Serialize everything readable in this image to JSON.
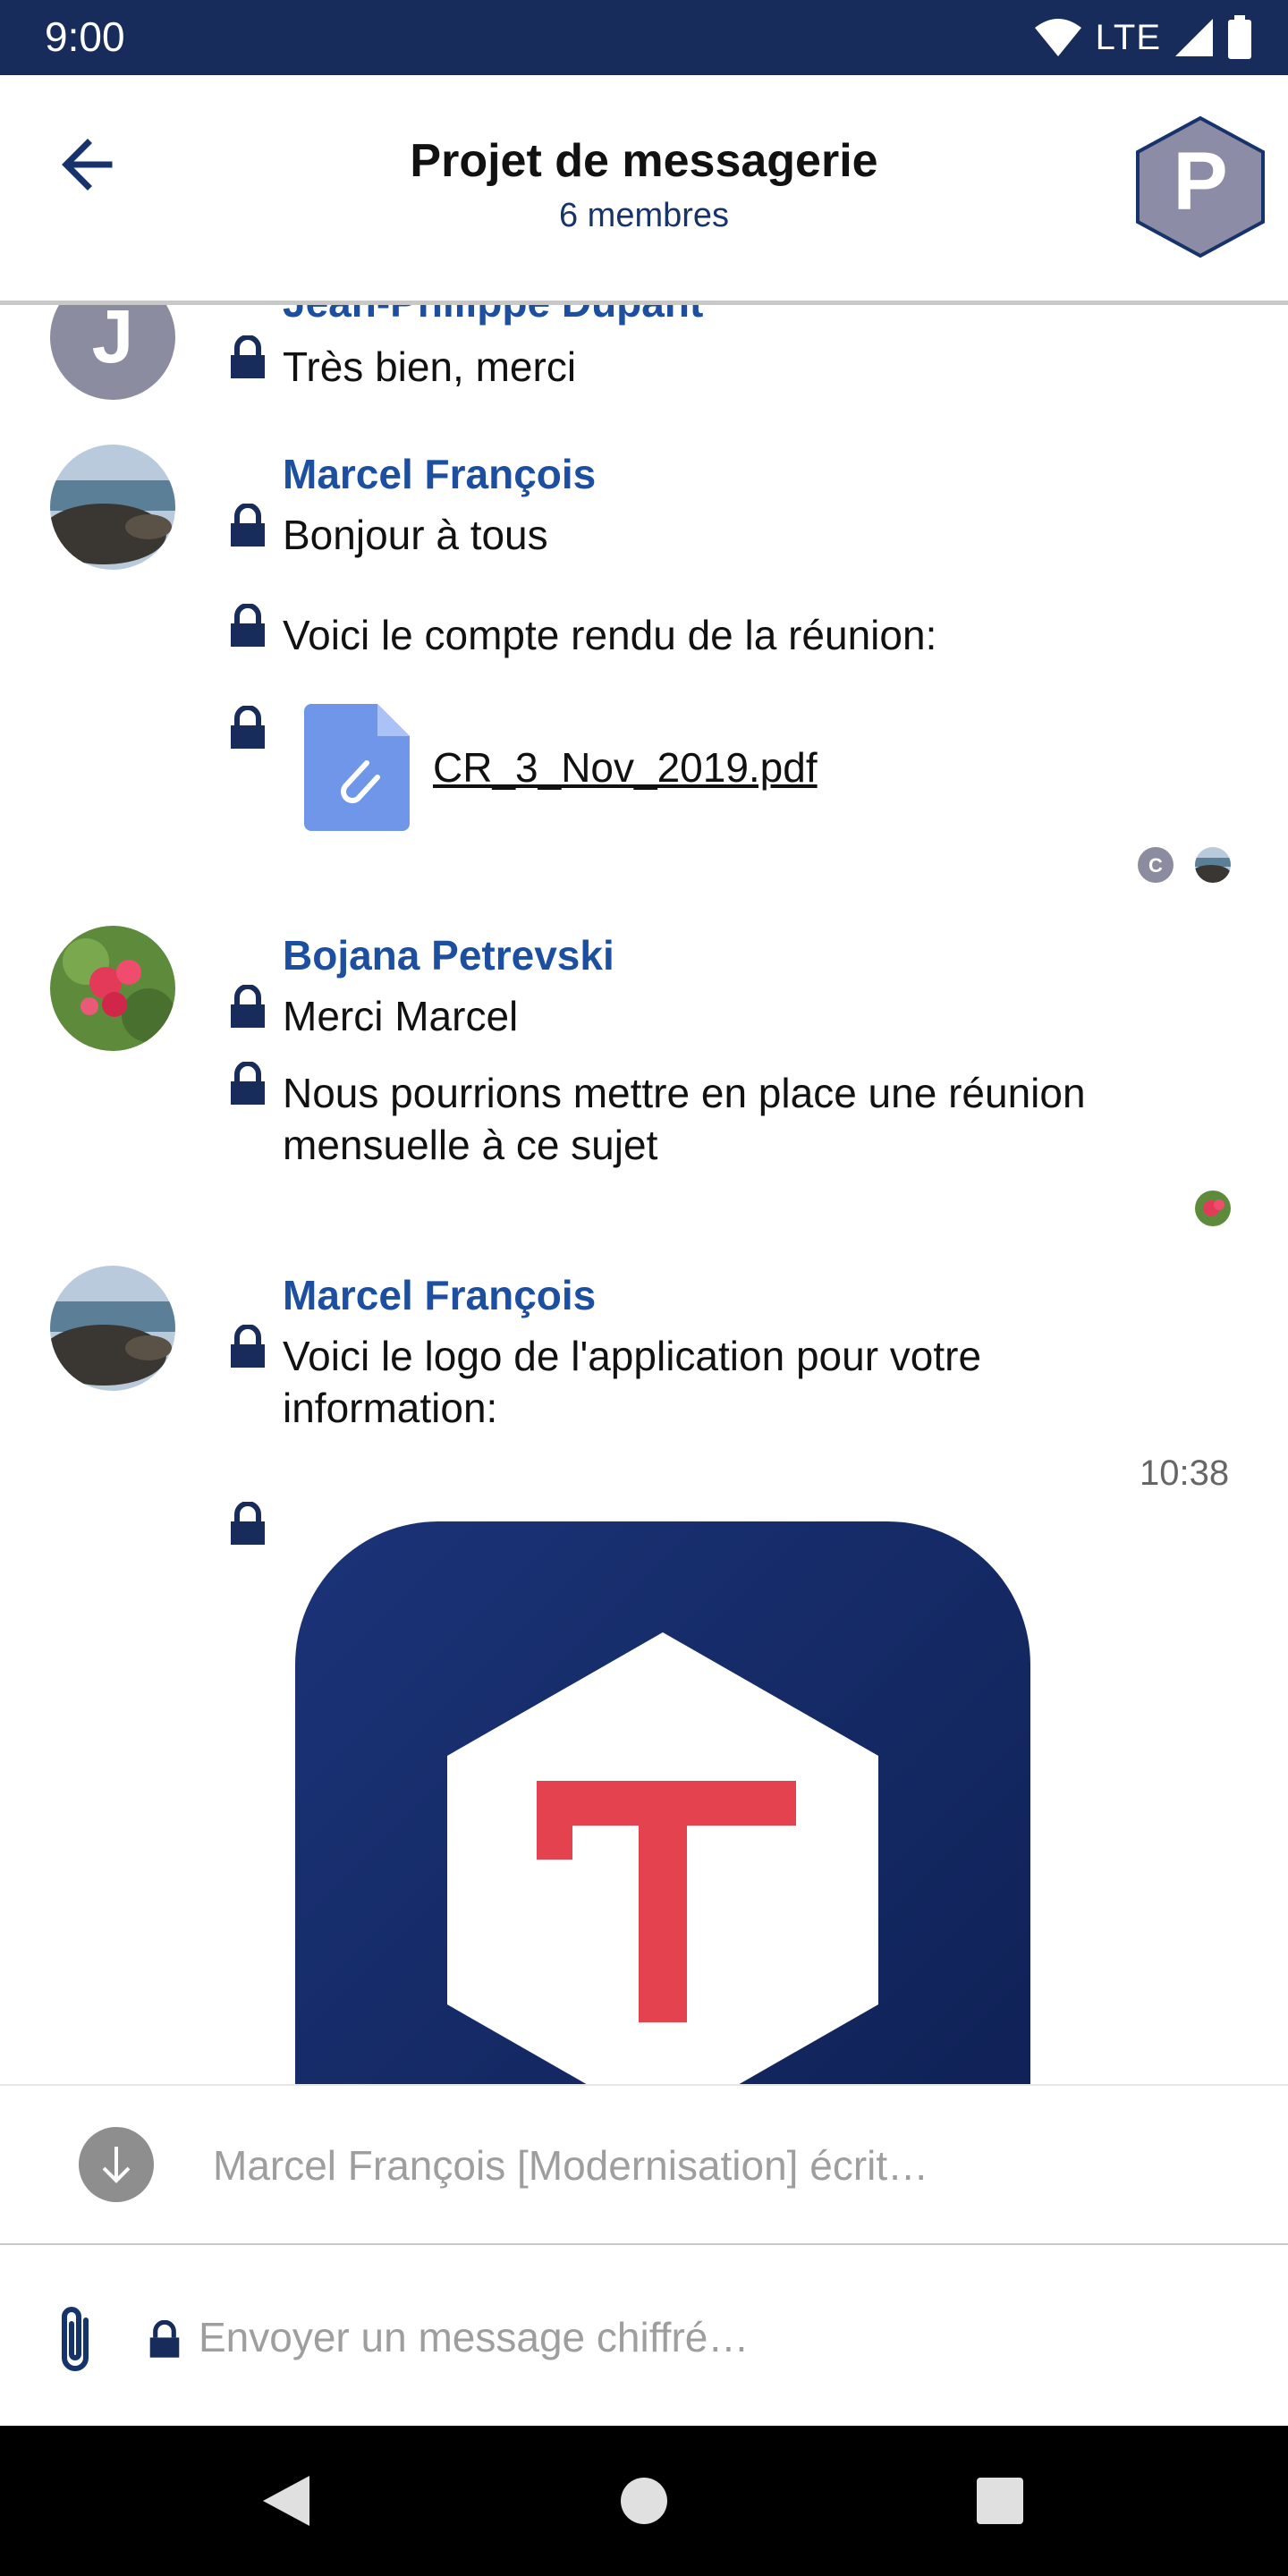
{
  "status_bar": {
    "time": "9:00",
    "network": "LTE"
  },
  "header": {
    "back_label": "←",
    "title": "Projet de messagerie",
    "subtitle": "6 membres",
    "room_initial": "P"
  },
  "messages": [
    {
      "sender": "Jean-Philippe Dupant",
      "avatar_initial": "J",
      "lines": [
        "Très bien, merci"
      ]
    },
    {
      "sender": "Marcel François",
      "lines": [
        "Bonjour à tous",
        "Voici le compte rendu de la réunion:"
      ],
      "file": "CR_3_Nov_2019.pdf",
      "receipt_initial": "C"
    },
    {
      "sender": "Bojana Petrevski",
      "lines": [
        "Merci Marcel",
        "Nous pourrions mettre en place une réunion mensuelle à ce sujet"
      ]
    },
    {
      "sender": "Marcel François",
      "lines": [
        "Voici le logo de l'application pour votre information:"
      ],
      "timestamp": "10:38",
      "image_glyph": "T"
    }
  ],
  "typing_indicator": "Marcel François [Modernisation] écrit…",
  "composer": {
    "placeholder": "Envoyer un message chiffré…"
  },
  "colors": {
    "status_bar": "#172c5a",
    "sender_name": "#1d4fa0",
    "lock": "#172c5a",
    "file_icon": "#6f96e8",
    "logo_background": "#14296a",
    "logo_letter": "#e5424f",
    "nav_bar": "#000000"
  }
}
